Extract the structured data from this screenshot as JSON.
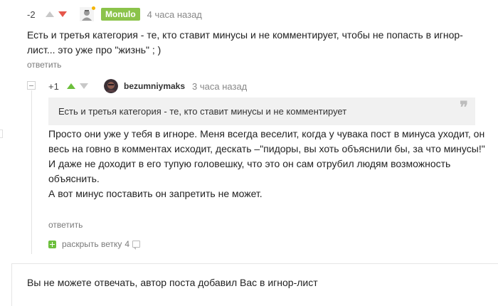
{
  "comment1": {
    "rating": "-2",
    "username": "Monulo",
    "time": "4 часа назад",
    "text": "Есть и третья категория - те, кто ставит минусы и не комментирует, чтобы не попасть в игнор-лист... это уже про \"жизнь\" ; )",
    "reply": "ответить",
    "username_badge_color": "#8bc34a"
  },
  "comment2": {
    "rating": "+1",
    "username": "bezumniymaks",
    "time": "3 часа назад",
    "quote": "Есть и третья категория - те, кто ставит минусы и не комментирует",
    "lines": [
      "Просто они уже у тебя в игноре. Меня всегда веселит, когда у чувака пост в минуса уходит, он весь на говно в комментах исходит, дескать –\"пидоры, вы хоть объяснили бы, за что минусы!\"",
      "И даже не доходит в его тупую головешку, что это он сам отрубил людям возможность объяснить.",
      "А вот минус поставить он запретить не может."
    ],
    "reply": "ответить"
  },
  "expand_branch": {
    "label": "раскрыть ветку",
    "count": "4"
  },
  "notice": "Вы не можете отвечать, автор поста добавил Вас в игнор-лист",
  "colors": {
    "upvote_active": "#6cbf3c",
    "downvote_active": "#e5574b",
    "vote_inactive": "#c8c8c8"
  }
}
